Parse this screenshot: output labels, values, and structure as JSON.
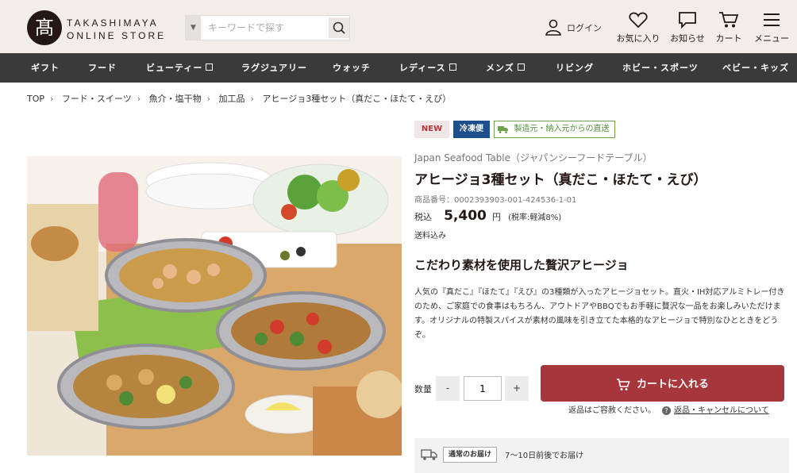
{
  "header": {
    "logo_char": "髙",
    "logo_line1": "TAKASHIMAYA",
    "logo_line2": "ONLINE STORE",
    "search_placeholder": "キーワードで探す",
    "login": "ログイン",
    "favorites": "お気に入り",
    "notifications": "お知らせ",
    "cart": "カート",
    "menu": "メニュー"
  },
  "nav": [
    "ギフト",
    "フード",
    "ビューティー",
    "ラグジュアリー",
    "ウォッチ",
    "レディース",
    "メンズ",
    "リビング",
    "ホビー・スポーツ",
    "ベビー・キッズ"
  ],
  "breadcrumb": [
    "TOP",
    "フード・スイーツ",
    "魚介・塩干物",
    "加工品",
    "アヒージョ3種セット（真だこ・ほたて・えび）"
  ],
  "product": {
    "badge_new": "NEW",
    "badge_cold": "冷凍便",
    "badge_direct": "製造元・納入元からの直送",
    "brand": "Japan Seafood Table（ジャパンシーフードテーブル）",
    "title": "アヒージョ3種セット（真だこ・ほたて・えび）",
    "code": "商品番号：0002393903-001-424536-1-01",
    "tax_in": "税込",
    "price": "5,400",
    "yen": "円",
    "tax_note": "(税率:軽減8%)",
    "shipping": "送料込み",
    "catch": "こだわり素材を使用した贅沢アヒージョ",
    "description": "人気の『真だこ』『ほたて』『えび』の3種類が入ったアヒージョセット。直火・IH対応アルミトレー付きのため、ご家庭での食事はもちろん、アウトドアやBBQでもお手軽に贅沢な一品をお楽しみいただけます。オリジナルの特製スパイスが素材の風味を引き立てた本格的なアヒージョで特別なひとときをどうぞ。"
  },
  "purchase": {
    "qty_label": "数量",
    "minus": "-",
    "qty": "1",
    "plus": "+",
    "cart_button": "カートに入れる",
    "return_note": "返品はご容赦ください。",
    "return_link": "返品・キャンセルについて"
  },
  "delivery": {
    "badge": "通常のお届け",
    "text": "7〜10日前後でお届け"
  }
}
